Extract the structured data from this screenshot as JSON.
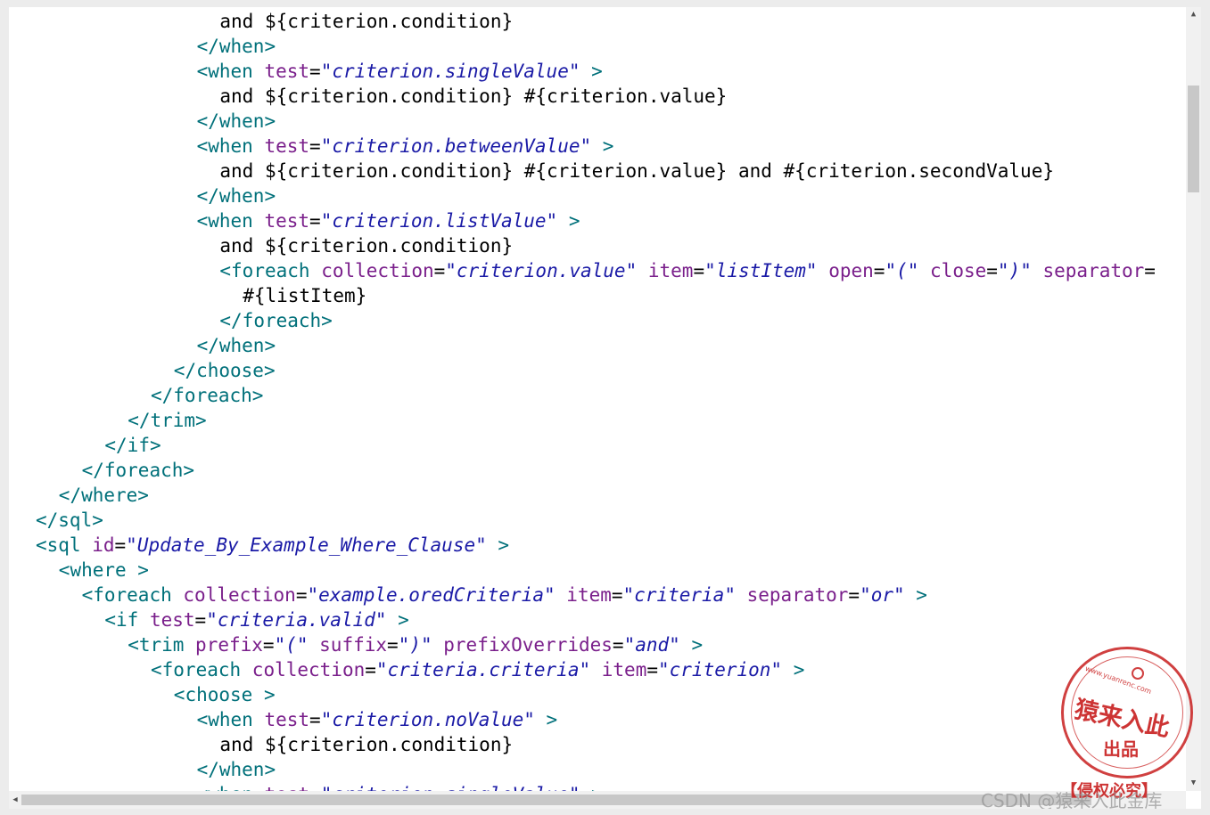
{
  "colors": {
    "tag": "#00707a",
    "attr": "#7a1f8b",
    "value": "#1a1aa6",
    "plain": "#000000"
  },
  "code_lines": [
    {
      "indent": 8,
      "tokens": [
        [
          "p",
          "and ${criterion.condition}"
        ]
      ]
    },
    {
      "indent": 7,
      "tokens": [
        [
          "t",
          "</when>"
        ]
      ]
    },
    {
      "indent": 7,
      "tokens": [
        [
          "t",
          "<when "
        ],
        [
          "a",
          "test"
        ],
        [
          "p",
          "="
        ],
        [
          "v",
          "\"criterion.singleValue\""
        ],
        [
          "t",
          " >"
        ]
      ]
    },
    {
      "indent": 8,
      "tokens": [
        [
          "p",
          "and ${criterion.condition} #{criterion.value}"
        ]
      ]
    },
    {
      "indent": 7,
      "tokens": [
        [
          "t",
          "</when>"
        ]
      ]
    },
    {
      "indent": 7,
      "tokens": [
        [
          "t",
          "<when "
        ],
        [
          "a",
          "test"
        ],
        [
          "p",
          "="
        ],
        [
          "v",
          "\"criterion.betweenValue\""
        ],
        [
          "t",
          " >"
        ]
      ]
    },
    {
      "indent": 8,
      "tokens": [
        [
          "p",
          "and ${criterion.condition} #{criterion.value} and #{criterion.secondValue}"
        ]
      ]
    },
    {
      "indent": 7,
      "tokens": [
        [
          "t",
          "</when>"
        ]
      ]
    },
    {
      "indent": 7,
      "tokens": [
        [
          "t",
          "<when "
        ],
        [
          "a",
          "test"
        ],
        [
          "p",
          "="
        ],
        [
          "v",
          "\"criterion.listValue\""
        ],
        [
          "t",
          " >"
        ]
      ]
    },
    {
      "indent": 8,
      "tokens": [
        [
          "p",
          "and ${criterion.condition}"
        ]
      ]
    },
    {
      "indent": 8,
      "tokens": [
        [
          "t",
          "<foreach "
        ],
        [
          "a",
          "collection"
        ],
        [
          "p",
          "="
        ],
        [
          "v",
          "\"criterion.value\""
        ],
        [
          "p",
          " "
        ],
        [
          "a",
          "item"
        ],
        [
          "p",
          "="
        ],
        [
          "v",
          "\"listItem\""
        ],
        [
          "p",
          " "
        ],
        [
          "a",
          "open"
        ],
        [
          "p",
          "="
        ],
        [
          "v",
          "\"(\""
        ],
        [
          "p",
          " "
        ],
        [
          "a",
          "close"
        ],
        [
          "p",
          "="
        ],
        [
          "v",
          "\")\""
        ],
        [
          "p",
          " "
        ],
        [
          "a",
          "separator"
        ],
        [
          "p",
          "="
        ]
      ]
    },
    {
      "indent": 9,
      "tokens": [
        [
          "p",
          "#{listItem}"
        ]
      ]
    },
    {
      "indent": 8,
      "tokens": [
        [
          "t",
          "</foreach>"
        ]
      ]
    },
    {
      "indent": 7,
      "tokens": [
        [
          "t",
          "</when>"
        ]
      ]
    },
    {
      "indent": 6,
      "tokens": [
        [
          "t",
          "</choose>"
        ]
      ]
    },
    {
      "indent": 5,
      "tokens": [
        [
          "t",
          "</foreach>"
        ]
      ]
    },
    {
      "indent": 4,
      "tokens": [
        [
          "t",
          "</trim>"
        ]
      ]
    },
    {
      "indent": 3,
      "tokens": [
        [
          "t",
          "</if>"
        ]
      ]
    },
    {
      "indent": 2,
      "tokens": [
        [
          "t",
          "</foreach>"
        ]
      ]
    },
    {
      "indent": 1,
      "tokens": [
        [
          "t",
          "</where>"
        ]
      ]
    },
    {
      "indent": 0,
      "tokens": [
        [
          "t",
          "</sql>"
        ]
      ]
    },
    {
      "indent": 0,
      "tokens": [
        [
          "t",
          "<sql "
        ],
        [
          "a",
          "id"
        ],
        [
          "p",
          "="
        ],
        [
          "v",
          "\"Update_By_Example_Where_Clause\""
        ],
        [
          "t",
          " >"
        ]
      ]
    },
    {
      "indent": 1,
      "tokens": [
        [
          "t",
          "<where >"
        ]
      ]
    },
    {
      "indent": 2,
      "tokens": [
        [
          "t",
          "<foreach "
        ],
        [
          "a",
          "collection"
        ],
        [
          "p",
          "="
        ],
        [
          "v",
          "\"example.oredCriteria\""
        ],
        [
          "p",
          " "
        ],
        [
          "a",
          "item"
        ],
        [
          "p",
          "="
        ],
        [
          "v",
          "\"criteria\""
        ],
        [
          "p",
          " "
        ],
        [
          "a",
          "separator"
        ],
        [
          "p",
          "="
        ],
        [
          "v",
          "\"or\""
        ],
        [
          "t",
          " >"
        ]
      ]
    },
    {
      "indent": 3,
      "tokens": [
        [
          "t",
          "<if "
        ],
        [
          "a",
          "test"
        ],
        [
          "p",
          "="
        ],
        [
          "v",
          "\"criteria.valid\""
        ],
        [
          "t",
          " >"
        ]
      ]
    },
    {
      "indent": 4,
      "tokens": [
        [
          "t",
          "<trim "
        ],
        [
          "a",
          "prefix"
        ],
        [
          "p",
          "="
        ],
        [
          "v",
          "\"(\""
        ],
        [
          "p",
          " "
        ],
        [
          "a",
          "suffix"
        ],
        [
          "p",
          "="
        ],
        [
          "v",
          "\")\""
        ],
        [
          "p",
          " "
        ],
        [
          "a",
          "prefixOverrides"
        ],
        [
          "p",
          "="
        ],
        [
          "v",
          "\"and\""
        ],
        [
          "t",
          " >"
        ]
      ]
    },
    {
      "indent": 5,
      "tokens": [
        [
          "t",
          "<foreach "
        ],
        [
          "a",
          "collection"
        ],
        [
          "p",
          "="
        ],
        [
          "v",
          "\"criteria.criteria\""
        ],
        [
          "p",
          " "
        ],
        [
          "a",
          "item"
        ],
        [
          "p",
          "="
        ],
        [
          "v",
          "\"criterion\""
        ],
        [
          "t",
          " >"
        ]
      ]
    },
    {
      "indent": 6,
      "tokens": [
        [
          "t",
          "<choose >"
        ]
      ]
    },
    {
      "indent": 7,
      "tokens": [
        [
          "t",
          "<when "
        ],
        [
          "a",
          "test"
        ],
        [
          "p",
          "="
        ],
        [
          "v",
          "\"criterion.noValue\""
        ],
        [
          "t",
          " >"
        ]
      ]
    },
    {
      "indent": 8,
      "tokens": [
        [
          "p",
          "and ${criterion.condition}"
        ]
      ]
    },
    {
      "indent": 7,
      "tokens": [
        [
          "t",
          "</when>"
        ]
      ]
    },
    {
      "indent": 7,
      "tokens": [
        [
          "t",
          "<when "
        ],
        [
          "a",
          "test"
        ],
        [
          "p",
          "="
        ],
        [
          "v",
          "\"criterion.singleValue\""
        ],
        [
          "t",
          " >"
        ]
      ]
    }
  ],
  "seal": {
    "url": "www.yuanrenc.com",
    "name": "猿来入此",
    "sub": "出品",
    "notice": "【侵权必究】"
  },
  "watermark": "CSDN @猿来入此金库"
}
